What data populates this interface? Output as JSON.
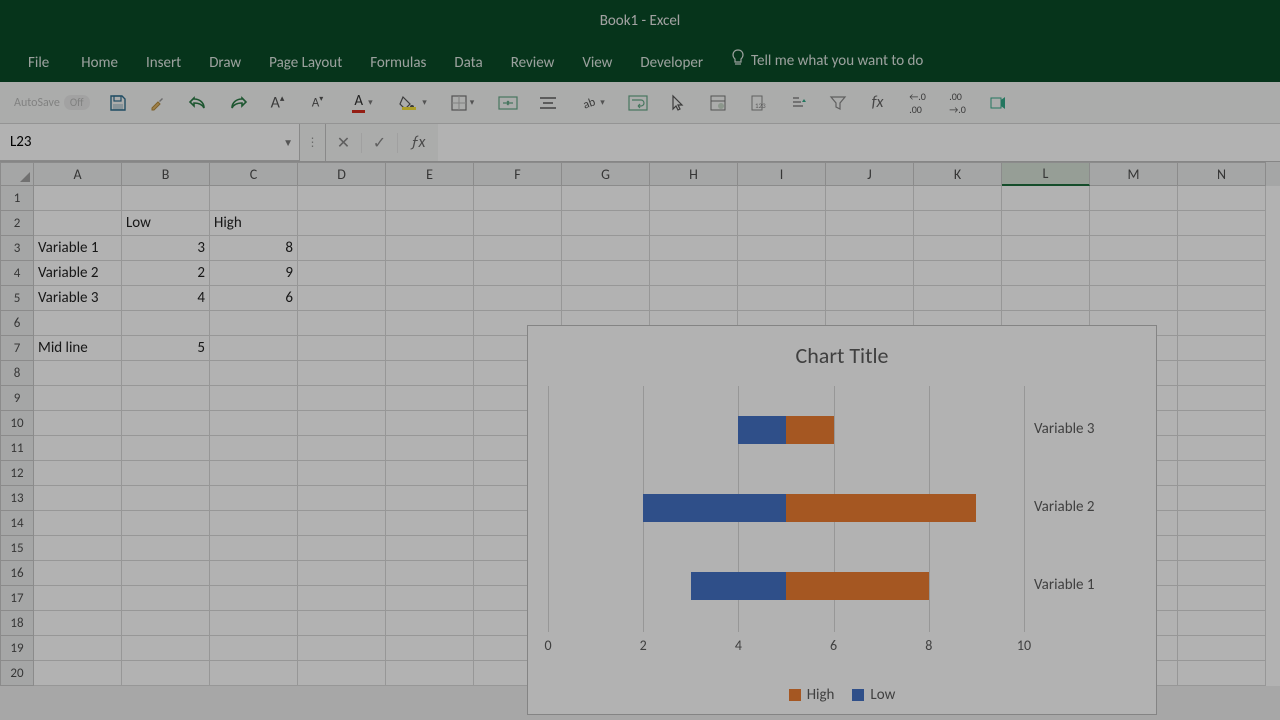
{
  "title": "Book1  -  Excel",
  "tabs": {
    "file": "File",
    "home": "Home",
    "insert": "Insert",
    "draw": "Draw",
    "page_layout": "Page Layout",
    "formulas": "Formulas",
    "data": "Data",
    "review": "Review",
    "view": "View",
    "developer": "Developer",
    "tell_me": "Tell me what you want to do"
  },
  "qat": {
    "autosave_label": "AutoSave",
    "autosave_state": "Off"
  },
  "name_box": "L23",
  "formula": "",
  "columns": [
    "A",
    "B",
    "C",
    "D",
    "E",
    "F",
    "G",
    "H",
    "I",
    "J",
    "K",
    "L",
    "M",
    "N"
  ],
  "selected_col": "L",
  "rows_count": 20,
  "cells": {
    "B2": "Low",
    "C2": "High",
    "A3": "Variable 1",
    "B3": "3",
    "C3": "8",
    "A4": "Variable 2",
    "B4": "2",
    "C4": "9",
    "A5": "Variable 3",
    "B5": "4",
    "C5": "6",
    "A7": "Mid line",
    "B7": "5"
  },
  "chart": {
    "title": "Chart Title",
    "legend": {
      "high": "High",
      "low": "Low"
    },
    "x_ticks": [
      "0",
      "2",
      "4",
      "6",
      "8",
      "10"
    ],
    "categories": [
      "Variable 3",
      "Variable 2",
      "Variable 1"
    ]
  },
  "chart_data": {
    "type": "bar",
    "title": "Chart Title",
    "xlabel": "",
    "ylabel": "",
    "xlim": [
      0,
      10
    ],
    "categories": [
      "Variable 1",
      "Variable 2",
      "Variable 3"
    ],
    "series": [
      {
        "name": "Low",
        "values": [
          3,
          2,
          4
        ],
        "start": [
          2,
          2,
          4
        ]
      },
      {
        "name": "High",
        "values": [
          3,
          4,
          1
        ],
        "start": [
          5,
          5,
          5
        ]
      }
    ],
    "legend_position": "bottom"
  },
  "colors": {
    "low": "#4472c4",
    "high": "#ed7d31",
    "green": "#0a4b27"
  }
}
